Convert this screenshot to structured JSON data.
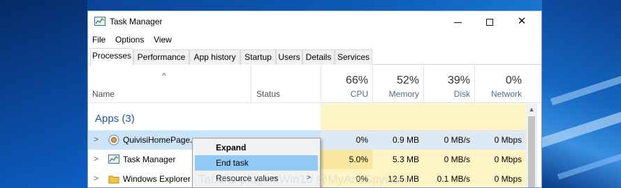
{
  "window": {
    "title": "Task Manager"
  },
  "menu": [
    "File",
    "Options",
    "View"
  ],
  "tabs": [
    "Processes",
    "Performance",
    "App history",
    "Startup",
    "Users",
    "Details",
    "Services"
  ],
  "columns": {
    "name": "Name",
    "status": "Status",
    "cpu": {
      "pct": "66%",
      "label": "CPU"
    },
    "memory": {
      "pct": "52%",
      "label": "Memory"
    },
    "disk": {
      "pct": "39%",
      "label": "Disk"
    },
    "network": {
      "pct": "0%",
      "label": "Network"
    }
  },
  "group": {
    "label": "Apps (3)"
  },
  "rows": [
    {
      "name": "QuivisiHomePage...",
      "icon": "globe-icon",
      "cpu": "0%",
      "memory": "0.9 MB",
      "disk": "0 MB/s",
      "network": "0 Mbps"
    },
    {
      "name": "Task Manager",
      "icon": "task-manager-icon",
      "cpu": "5.0%",
      "memory": "5.3 MB",
      "disk": "0 MB/s",
      "network": "0 Mbps"
    },
    {
      "name": "Windows Explorer",
      "icon": "folder-icon",
      "cpu": "0%",
      "memory": "12.5 MB",
      "disk": "0.1 MB/s",
      "network": "0 Mbps"
    }
  ],
  "context_menu": [
    "Expand",
    "End task",
    "Resource values"
  ],
  "watermark": "Tabular plugin: Win10 @MyAntiSpyware",
  "colors": {
    "selected_row": "#cce4f7",
    "highlight": "#91c9f7",
    "heat_yellow": "#fff4c4",
    "group_label": "#1e5aa8"
  }
}
